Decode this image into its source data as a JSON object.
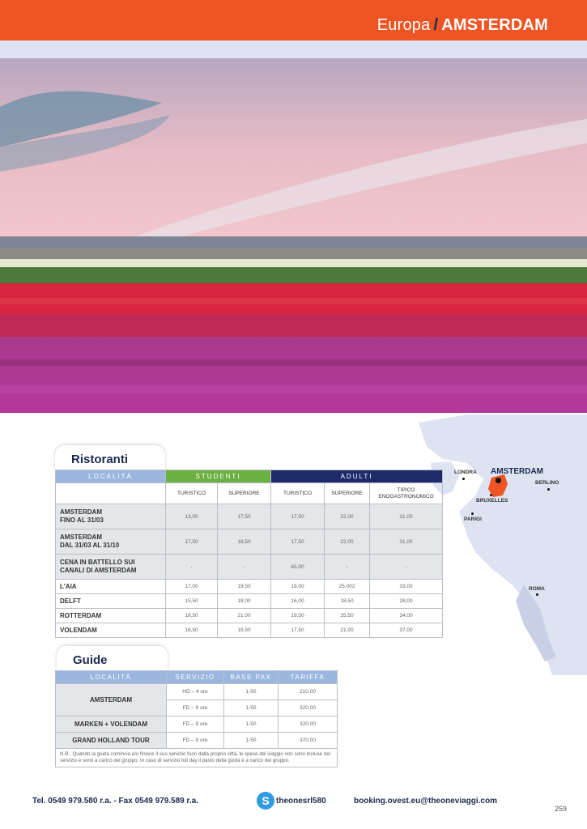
{
  "header": {
    "region": "Europa",
    "separator": "/",
    "city": "AMSTERDAM"
  },
  "map": {
    "labels": {
      "londra": "LONDRA",
      "amsterdam": "AMSTERDAM",
      "berlino": "BERLINO",
      "bruxelles": "BRUXELLES",
      "parigi": "PARIGI",
      "roma": "ROMA"
    },
    "highlight_color": "#ee5424"
  },
  "ristoranti": {
    "section_title": "Ristoranti",
    "headers": {
      "localita": "LOCALITÀ",
      "studenti": "STUDENTI",
      "adulti": "ADULTI"
    },
    "subheaders": [
      "TURISTICO",
      "SUPERIORE",
      "TURISTICO",
      "SUPERIORE",
      "TIPICO ENOGASTRONOMICO"
    ],
    "rows": [
      {
        "line1": "AMSTERDAM",
        "line2": "FINO AL 31/03",
        "values": [
          "13,00",
          "17,50",
          "17,50",
          "22,00",
          "31,00"
        ]
      },
      {
        "line1": "AMSTERDAM",
        "line2": "DAL 31/03 AL 31/10",
        "values": [
          "17,50",
          "18,50",
          "17,50",
          "22,00",
          "31,00"
        ]
      },
      {
        "line1": "CENA IN BATTELLO SUI",
        "line2": "CANALI DI AMSTERDAM",
        "values": [
          "-",
          "-",
          "65,00",
          "-",
          "-"
        ]
      },
      {
        "line1": "L'AIA",
        "line2": "",
        "values": [
          "17,00",
          "19,50",
          "19,00",
          "25,002",
          "33,00"
        ]
      },
      {
        "line1": "DELFT",
        "line2": "",
        "values": [
          "15,50",
          "18,00",
          "16,00",
          "18,50",
          "28,00"
        ]
      },
      {
        "line1": "ROTTERDAM",
        "line2": "",
        "values": [
          "18,50",
          "21,00",
          "19,50",
          "25,50",
          "34,00"
        ]
      },
      {
        "line1": "VOLENDAM",
        "line2": "",
        "values": [
          "16,50",
          "19,50",
          "17,50",
          "21,00",
          "37,00"
        ]
      }
    ]
  },
  "guide": {
    "section_title": "Guide",
    "headers": {
      "localita": "LOCALITÀ",
      "servizio": "SERVIZIO",
      "base_pax": "BASE PAX",
      "tariffa": "TARIFFA"
    },
    "rows": [
      {
        "name": "AMSTERDAM",
        "servizio": "HD – 4 ore",
        "pax": "1-50",
        "tariffa": "210,00"
      },
      {
        "name": "",
        "servizio": "FD – 9 ore",
        "pax": "1-50",
        "tariffa": "320,00"
      },
      {
        "name": "MARKEN + VOLENDAM",
        "servizio": "FD – 9 ore",
        "pax": "1-50",
        "tariffa": "320,00"
      },
      {
        "name": "GRAND HOLLAND TOUR",
        "servizio": "FD – 9 ore",
        "pax": "1-50",
        "tariffa": "370,00"
      }
    ],
    "note": "N.B.: Quando la guida comincia e/o finisce il suo servizio fuori dalla proprio città, le spese del viaggio non sono incluse nel servizio e sono a carico del gruppo. In caso di servizio full day il pasto della guida è a carico del gruppo."
  },
  "footer": {
    "phone": "Tel. 0549 979.580 r.a. - Fax 0549 979.589 r.a.",
    "skype_icon_letter": "S",
    "skype": "theonesrl580",
    "email": "booking.ovest.eu@theoneviaggi.com",
    "page_number": "259"
  }
}
